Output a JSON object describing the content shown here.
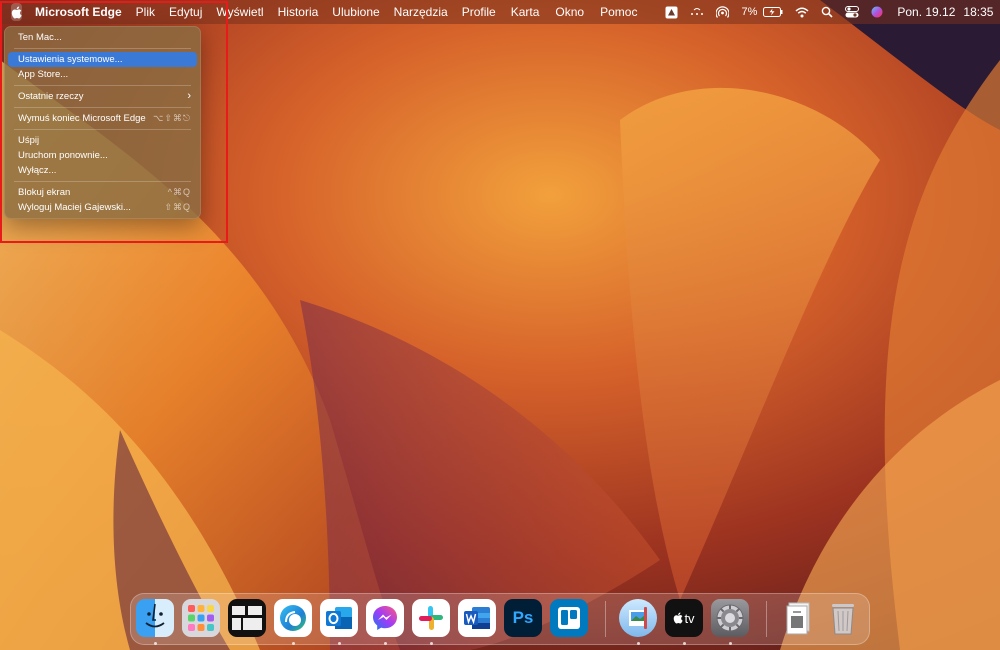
{
  "menubar": {
    "app_name": "Microsoft Edge",
    "items": [
      "Plik",
      "Edytuj",
      "Wyświetl",
      "Historia",
      "Ulubione",
      "Narzędzia",
      "Profile"
    ],
    "right_items": [
      "Karta",
      "Okno",
      "Pomoc"
    ],
    "battery_percent": "7%",
    "date": "Pon. 19.12",
    "time": "18:35"
  },
  "apple_menu": {
    "items": [
      {
        "label": "Ten Mac..."
      },
      {
        "label": "Ustawienia systemowe...",
        "highlighted": true
      },
      {
        "label": "App Store..."
      },
      {
        "label": "Ostatnie rzeczy",
        "submenu_indicator": "›"
      },
      {
        "label": "Wymuś koniec Microsoft Edge",
        "shortcut": "⌥⇧⌘⎋"
      },
      {
        "label": "Uśpij"
      },
      {
        "label": "Uruchom ponownie..."
      },
      {
        "label": "Wyłącz..."
      },
      {
        "label": "Blokuj ekran",
        "shortcut": "^⌘Q"
      },
      {
        "label": "Wyloguj Maciej Gajewski...",
        "shortcut": "⇧⌘Q"
      }
    ]
  },
  "dock": {
    "apps": [
      {
        "name": "Finder",
        "icon": "finder-icon",
        "running": true
      },
      {
        "name": "Launchpad",
        "icon": "launchpad-icon",
        "running": false
      },
      {
        "name": "Mission Control",
        "icon": "mission-control-icon",
        "running": false
      },
      {
        "name": "Microsoft Edge",
        "icon": "edge-icon",
        "running": true
      },
      {
        "name": "Microsoft Outlook",
        "icon": "outlook-icon",
        "running": true
      },
      {
        "name": "Messenger",
        "icon": "messenger-icon",
        "running": true
      },
      {
        "name": "Slack",
        "icon": "slack-icon",
        "running": true
      },
      {
        "name": "Microsoft Word",
        "icon": "word-icon",
        "running": false
      },
      {
        "name": "Photoshop",
        "icon": "photoshop-icon",
        "running": false,
        "label": "Ps"
      },
      {
        "name": "Trello",
        "icon": "trello-icon",
        "running": false
      },
      {
        "name": "Preview",
        "icon": "preview-icon",
        "running": true
      },
      {
        "name": "Apple TV",
        "icon": "apple-tv-icon",
        "running": true,
        "label": "tv"
      },
      {
        "name": "Ustawienia systemowe",
        "icon": "settings-icon",
        "running": true
      },
      {
        "name": "Documents",
        "icon": "document-stack-icon",
        "running": false
      },
      {
        "name": "Trash",
        "icon": "trash-icon",
        "running": false
      }
    ]
  },
  "colors": {
    "highlight": "#3b79d6",
    "annotation_box": "#e81a1a"
  }
}
